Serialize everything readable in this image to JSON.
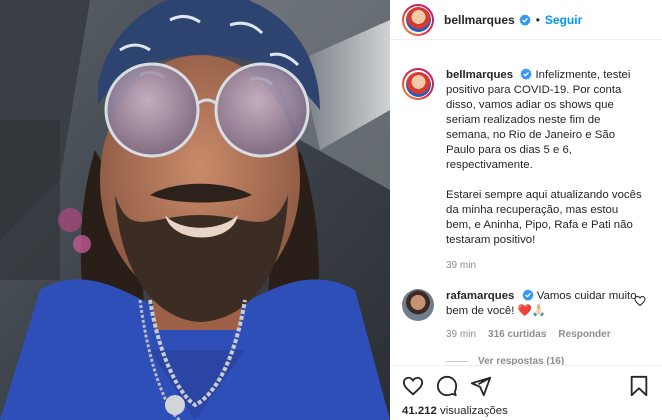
{
  "post": {
    "username": "bellmarques",
    "follow_label": "Seguir",
    "separator": "•",
    "caption_text": "Infelizmente, testei positivo para COVID-19. Por conta disso, vamos adiar os shows que seriam realizados neste fim de semana, no Rio de Janeiro e São Paulo para os dias 5 e 6, respectivamente.\n\nEstarei sempre aqui atualizando vocês da minha recuperação, mas estou bem, e Aninha, Pipo, Rafa e Pati não testaram positivo!",
    "caption_time": "39 min"
  },
  "comment": {
    "username": "rafamarques",
    "text": "Vamos cuidar muito bem de você! ❤️🙏🏻",
    "time": "39 min",
    "likes": "316 curtidas",
    "reply_label": "Responder",
    "view_replies": "Ver respostas (16)"
  },
  "footer": {
    "views_count": "41.212",
    "views_label": "visualizações"
  },
  "icons": {
    "like": "heart-icon",
    "comment": "comment-icon",
    "share": "share-icon",
    "save": "bookmark-icon",
    "verified": "verified-badge-icon"
  },
  "colors": {
    "link_blue": "#0095f6",
    "verified_blue": "#3897f0",
    "muted_text": "#8e8e8e",
    "text": "#262626"
  }
}
